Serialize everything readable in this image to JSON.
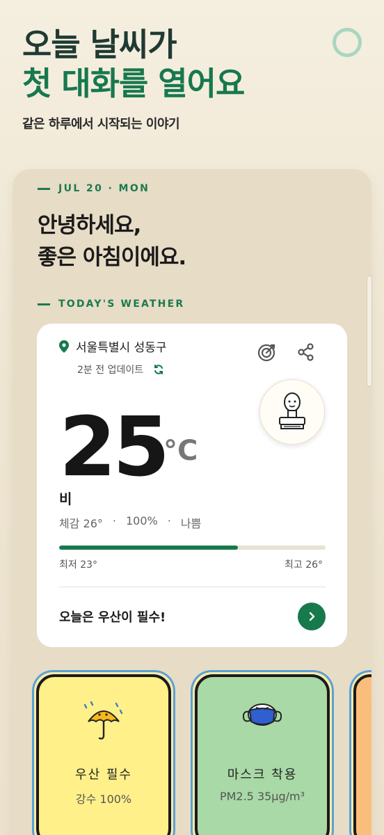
{
  "promo": {
    "title_line1": "오늘 날씨가",
    "title_line2": "첫 대화를 열어요",
    "subtitle": "같은 하루에서 시작되는 이야기"
  },
  "app": {
    "date": "JUL 20 · MON",
    "greeting_line1": "안녕하세요,",
    "greeting_line2": "좋은 아침이에요.",
    "section_label": "TODAY'S WEATHER"
  },
  "weather": {
    "location": "서울특별시 성동구",
    "updated": "2분 전 업데이트",
    "temperature": "25",
    "unit": "°C",
    "condition": "비",
    "feels_like": "체감 26°",
    "sep1": "·",
    "precipitation": "100%",
    "sep2": "·",
    "air_quality": "나쁨",
    "range_fraction": 0.67,
    "low": "최저 23°",
    "high": "최고 26°",
    "tip": "오늘은 우산이 필수!"
  },
  "cards": [
    {
      "title": "우산 필수",
      "detail": "강수 100%",
      "icon": "umbrella-rain-icon"
    },
    {
      "title": "마스크 착용",
      "detail": "PM2.5 35μg/m³",
      "icon": "mask-icon"
    }
  ],
  "colors": {
    "accent": "#167a4d",
    "card_yellow": "#fff08a",
    "card_green": "#a8d9a6",
    "card_orange": "#f9be7c"
  }
}
